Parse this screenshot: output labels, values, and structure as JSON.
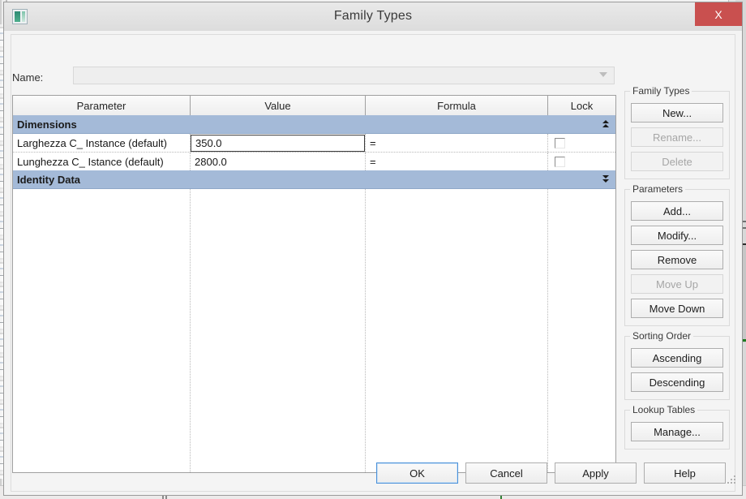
{
  "window": {
    "title": "Family Types",
    "app_icon": "family-editor-icon",
    "close_label": "X"
  },
  "name_row": {
    "label": "Name:",
    "value": "",
    "placeholder": "",
    "dropdown_icon": "chevron-down-icon"
  },
  "table": {
    "columns": [
      "Parameter",
      "Value",
      "Formula",
      "Lock"
    ],
    "groups": [
      {
        "label": "Dimensions",
        "collapse_icon": "double-chevron-up-icon",
        "rows": [
          {
            "parameter": "Larghezza C_ Instance (default)",
            "value": "350.0",
            "formula": "=",
            "lock": false,
            "active": true
          },
          {
            "parameter": "Lunghezza C_ Istance (default)",
            "value": "2800.0",
            "formula": "=",
            "lock": false,
            "active": false
          }
        ]
      },
      {
        "label": "Identity Data",
        "collapse_icon": "double-chevron-down-icon",
        "rows": []
      }
    ]
  },
  "side_panels": [
    {
      "title": "Family Types",
      "buttons": [
        {
          "label": "New...",
          "disabled": false
        },
        {
          "label": "Rename...",
          "disabled": true
        },
        {
          "label": "Delete",
          "disabled": true
        }
      ]
    },
    {
      "title": "Parameters",
      "buttons": [
        {
          "label": "Add...",
          "disabled": false
        },
        {
          "label": "Modify...",
          "disabled": false
        },
        {
          "label": "Remove",
          "disabled": false
        },
        {
          "label": "Move Up",
          "disabled": true
        },
        {
          "label": "Move Down",
          "disabled": false
        }
      ]
    },
    {
      "title": "Sorting Order",
      "buttons": [
        {
          "label": "Ascending",
          "disabled": false
        },
        {
          "label": "Descending",
          "disabled": false
        }
      ]
    },
    {
      "title": "Lookup Tables",
      "buttons": [
        {
          "label": "Manage...",
          "disabled": false
        }
      ]
    }
  ],
  "footer": {
    "buttons": [
      {
        "label": "OK",
        "primary": true
      },
      {
        "label": "Cancel",
        "primary": false
      },
      {
        "label": "Apply",
        "primary": false
      },
      {
        "label": "Help",
        "primary": false
      }
    ],
    "resize_grip_icon": "resize-grip-icon"
  },
  "colors": {
    "group_header": "#a4bad8",
    "close_button": "#c9504f",
    "primary_outline": "#4a90d9",
    "dialog_background": "#f3f3f3"
  }
}
